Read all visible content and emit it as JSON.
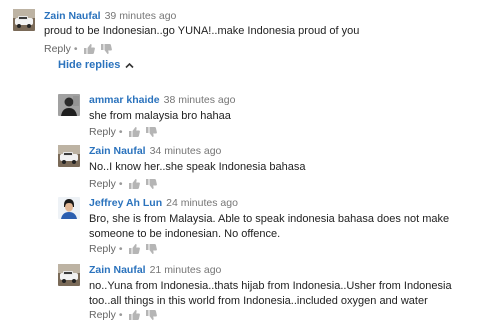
{
  "comments": [
    {
      "author": "Zain Naufal",
      "time": "39 minutes ago",
      "text": "proud to be Indonesian..go YUNA!..make Indonesia proud of you",
      "reply_label": "Reply",
      "avatar": "car-avatar-icon"
    },
    {
      "author": "ammar khaide",
      "time": "38 minutes ago",
      "text": "she from malaysia bro  hahaa",
      "reply_label": "Reply",
      "avatar": "person-photo-avatar"
    },
    {
      "author": "Zain Naufal",
      "time": "34 minutes ago",
      "text": "No..I know her..she speak Indonesia bahasa",
      "reply_label": "Reply",
      "avatar": "car-avatar-icon"
    },
    {
      "author": "Jeffrey Ah Lun",
      "time": "24 minutes ago",
      "text": "Bro, she is from Malaysia. Able to speak indonesia bahasa does not make someone to be indonesian. No offence.",
      "reply_label": "Reply",
      "avatar": "person-photo-avatar"
    },
    {
      "author": "Zain Naufal",
      "time": "21 minutes ago",
      "text": "no..Yuna from Indonesia..thats hijab from Indonesia..Usher from Indonesia too..all things in this world from Indonesia..included oxygen and water",
      "reply_label": "Reply",
      "avatar": "car-avatar-icon"
    }
  ],
  "hide_replies_label": "Hide replies",
  "colors": {
    "author": "#2b73bd",
    "meta": "#767676",
    "text": "#222222",
    "thumb": "#b5b5b5"
  }
}
